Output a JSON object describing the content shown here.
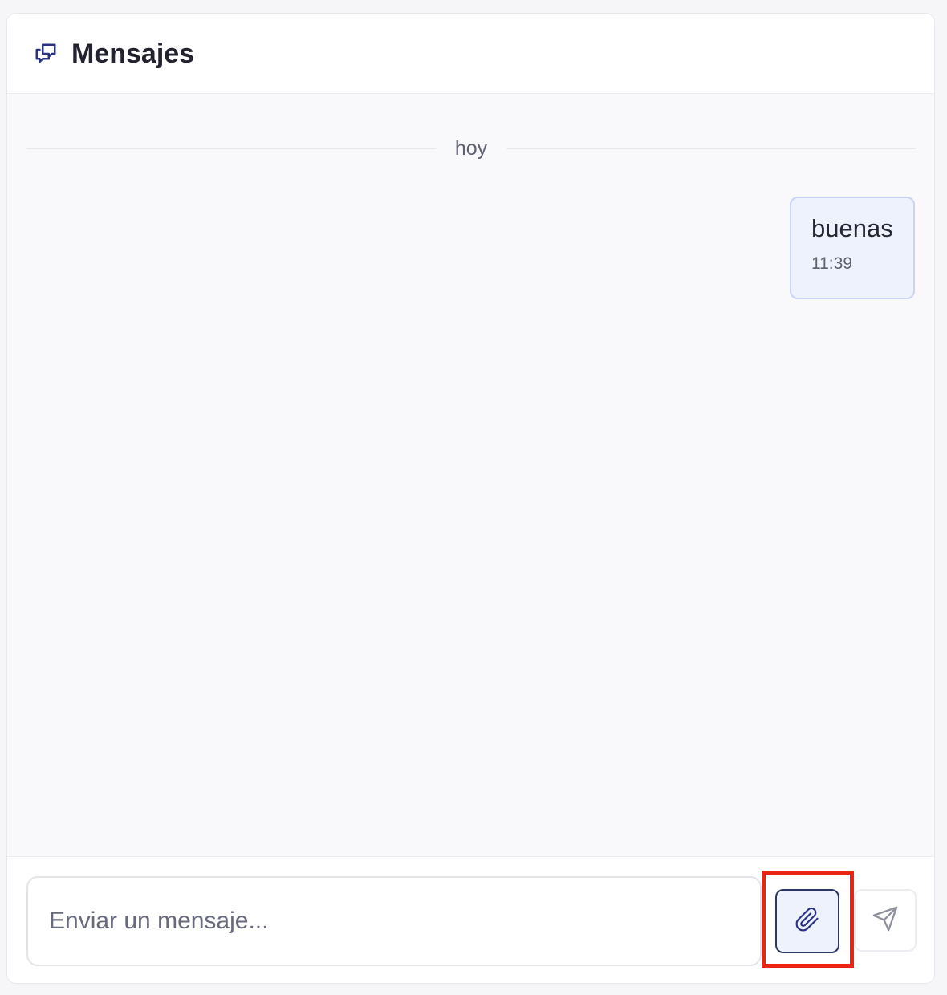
{
  "header": {
    "title": "Mensajes",
    "icon": "chat-bubbles-icon",
    "accent_color": "#2b3284"
  },
  "thread": {
    "date_label": "hoy",
    "messages": [
      {
        "text": "buenas",
        "time": "11:39",
        "sender": "self"
      }
    ]
  },
  "composer": {
    "placeholder": "Enviar un mensaje...",
    "value": "",
    "attach_icon": "paperclip-icon",
    "send_icon": "send-icon",
    "highlight_color": "#ea2613"
  }
}
